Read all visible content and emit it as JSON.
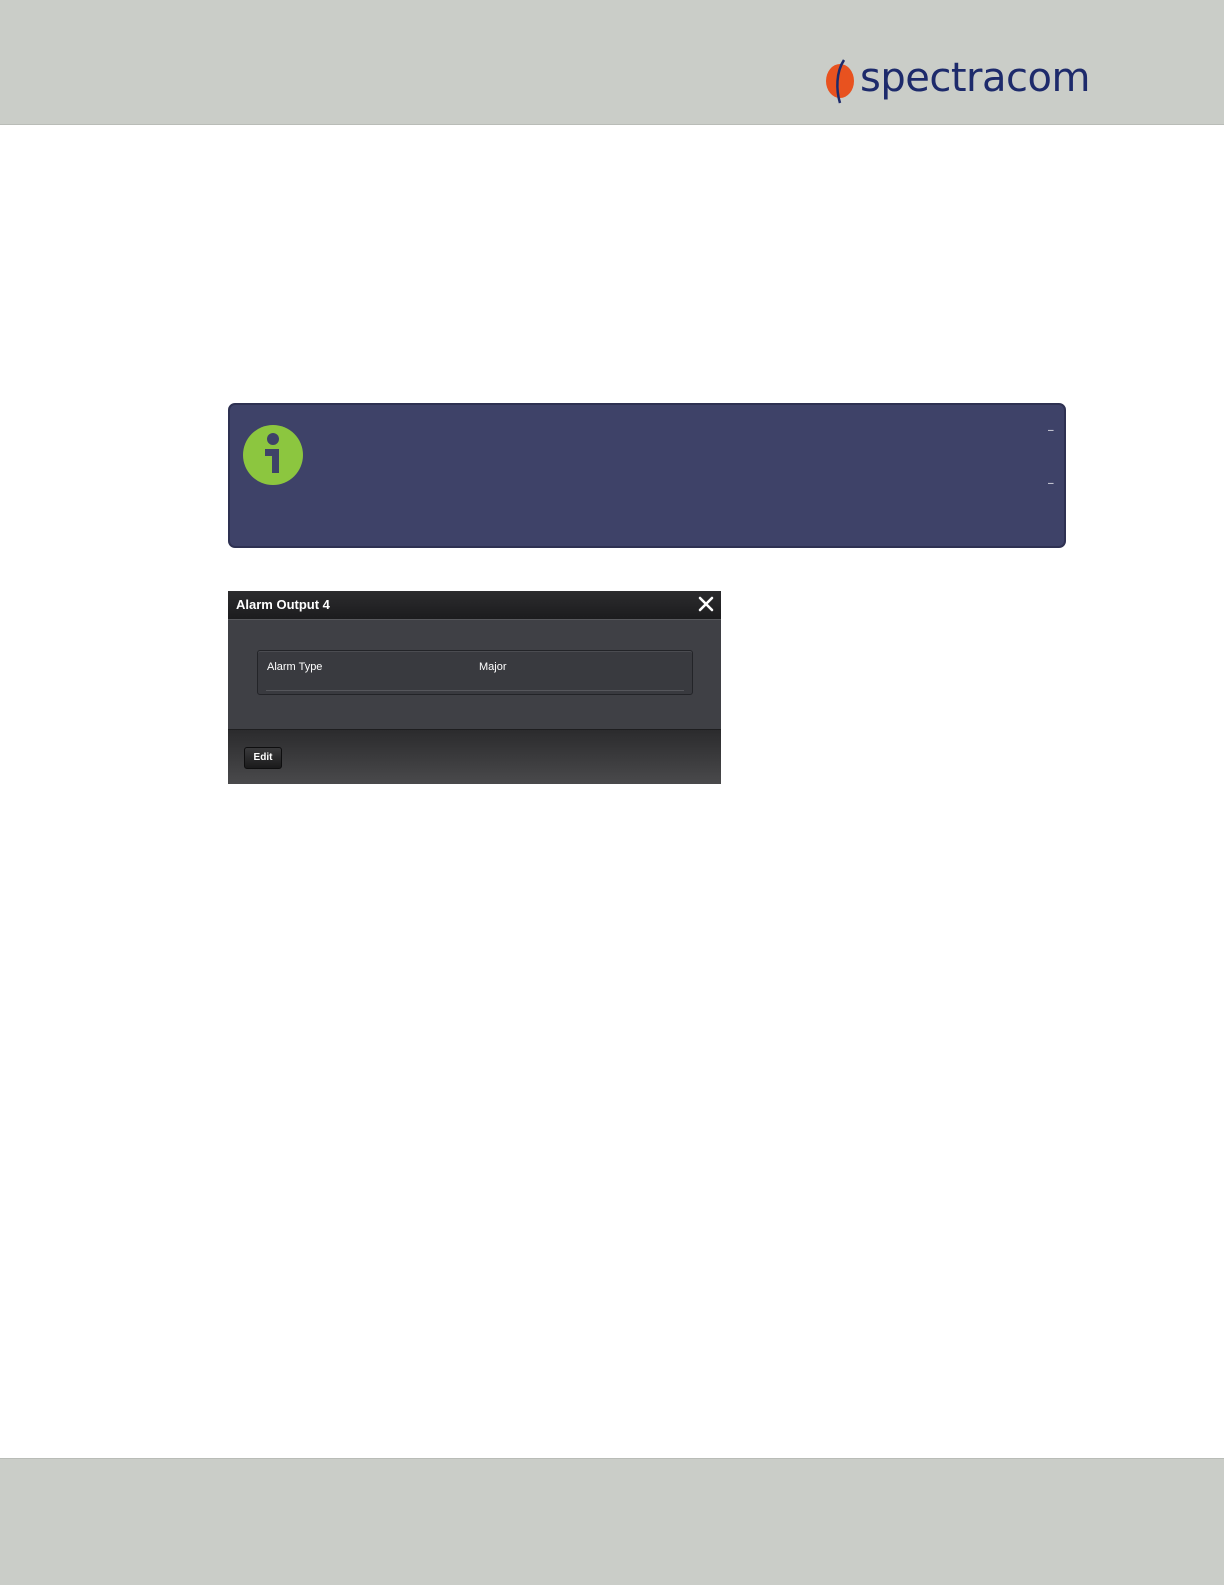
{
  "header": {
    "logo_text": "spectracom",
    "colors": {
      "band": "#cacdc8",
      "logo_text": "#1d2a6b",
      "logo_mark": "#e8521f"
    }
  },
  "note": {
    "icon": "info-icon",
    "colors": {
      "box": "#3e4268",
      "icon": "#8cc63f"
    }
  },
  "panel": {
    "title": "Alarm Output 4",
    "close_icon": "close-icon",
    "fields": [
      {
        "label": "Alarm Type",
        "value": "Major"
      }
    ],
    "edit_label": "Edit"
  },
  "footer": {
    "colors": {
      "band": "#cacdc8"
    }
  }
}
